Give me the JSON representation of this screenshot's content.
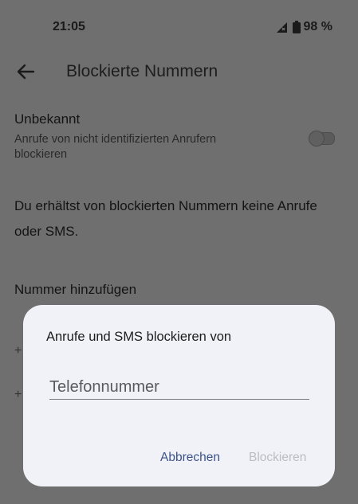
{
  "status_bar": {
    "time": "21:05",
    "battery": "98 %"
  },
  "app_bar": {
    "title": "Blockierte Nummern"
  },
  "setting": {
    "title": "Unbekannt",
    "summary": "Anrufe von nicht identifizierten Anrufern blockieren",
    "toggle_on": false
  },
  "info_text": "Du erhältst von blockierten Nummern keine Anrufe oder SMS.",
  "section": {
    "header": "Nummer hinzufügen"
  },
  "dialog": {
    "title": "Anrufe und SMS blockieren von",
    "input_placeholder": "Telefonnummer",
    "input_value": "",
    "cancel_label": "Abbrechen",
    "block_label": "Blockieren"
  },
  "colors": {
    "accent": "#3b5288",
    "disabled": "#bcbcc2",
    "scrim": "#6f6f6f",
    "dialog_bg": "#f1f2f7"
  }
}
